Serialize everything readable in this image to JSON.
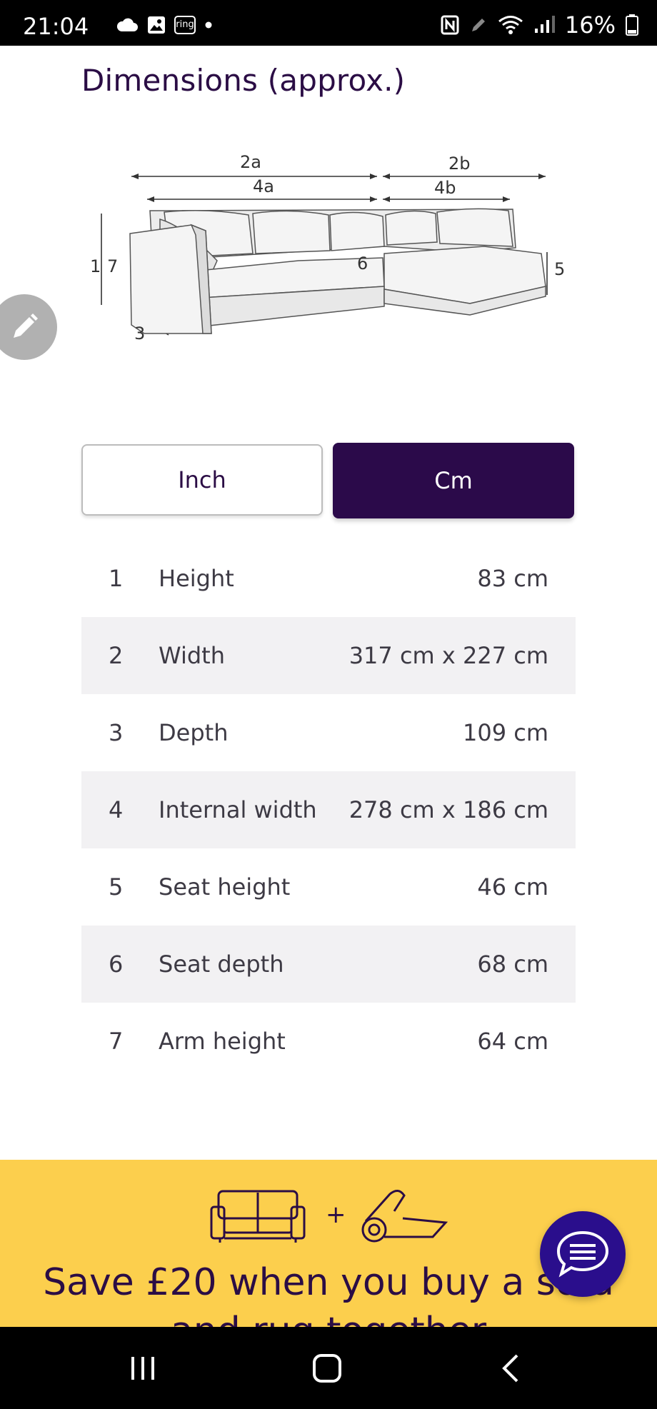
{
  "status_bar": {
    "time": "21:04",
    "battery": "16%",
    "left_icons": [
      "cloud-icon",
      "image-icon",
      "ring-icon",
      "dot-icon"
    ],
    "ring_label": "ring",
    "right_icons": [
      "nfc-icon",
      "pen-icon",
      "wifi-icon",
      "signal-icon",
      "battery-icon"
    ]
  },
  "page": {
    "title": "Dimensions (approx.)"
  },
  "diagram": {
    "labels": {
      "a2": "2a",
      "b2": "2b",
      "a4": "4a",
      "b4": "4b",
      "one": "1",
      "seven": "7",
      "three": "3",
      "six": "6",
      "five": "5"
    }
  },
  "unit_toggle": {
    "inch_label": "Inch",
    "cm_label": "Cm",
    "selected": "Cm"
  },
  "dimensions": [
    {
      "num": "1",
      "label": "Height",
      "value": "83 cm"
    },
    {
      "num": "2",
      "label": "Width",
      "value": "317 cm x 227 cm"
    },
    {
      "num": "3",
      "label": "Depth",
      "value": "109 cm"
    },
    {
      "num": "4",
      "label": "Internal width",
      "value": "278 cm x 186 cm"
    },
    {
      "num": "5",
      "label": "Seat height",
      "value": "46 cm"
    },
    {
      "num": "6",
      "label": "Seat depth",
      "value": "68 cm"
    },
    {
      "num": "7",
      "label": "Arm height",
      "value": "64 cm"
    }
  ],
  "promo": {
    "plus": "+",
    "line1": "Save £20 when you buy a sofa",
    "line2": "and rug together"
  },
  "colors": {
    "brand_purple": "#2b0a4a",
    "promo_yellow": "#fccf4d",
    "row_shade": "#f2f1f3"
  }
}
